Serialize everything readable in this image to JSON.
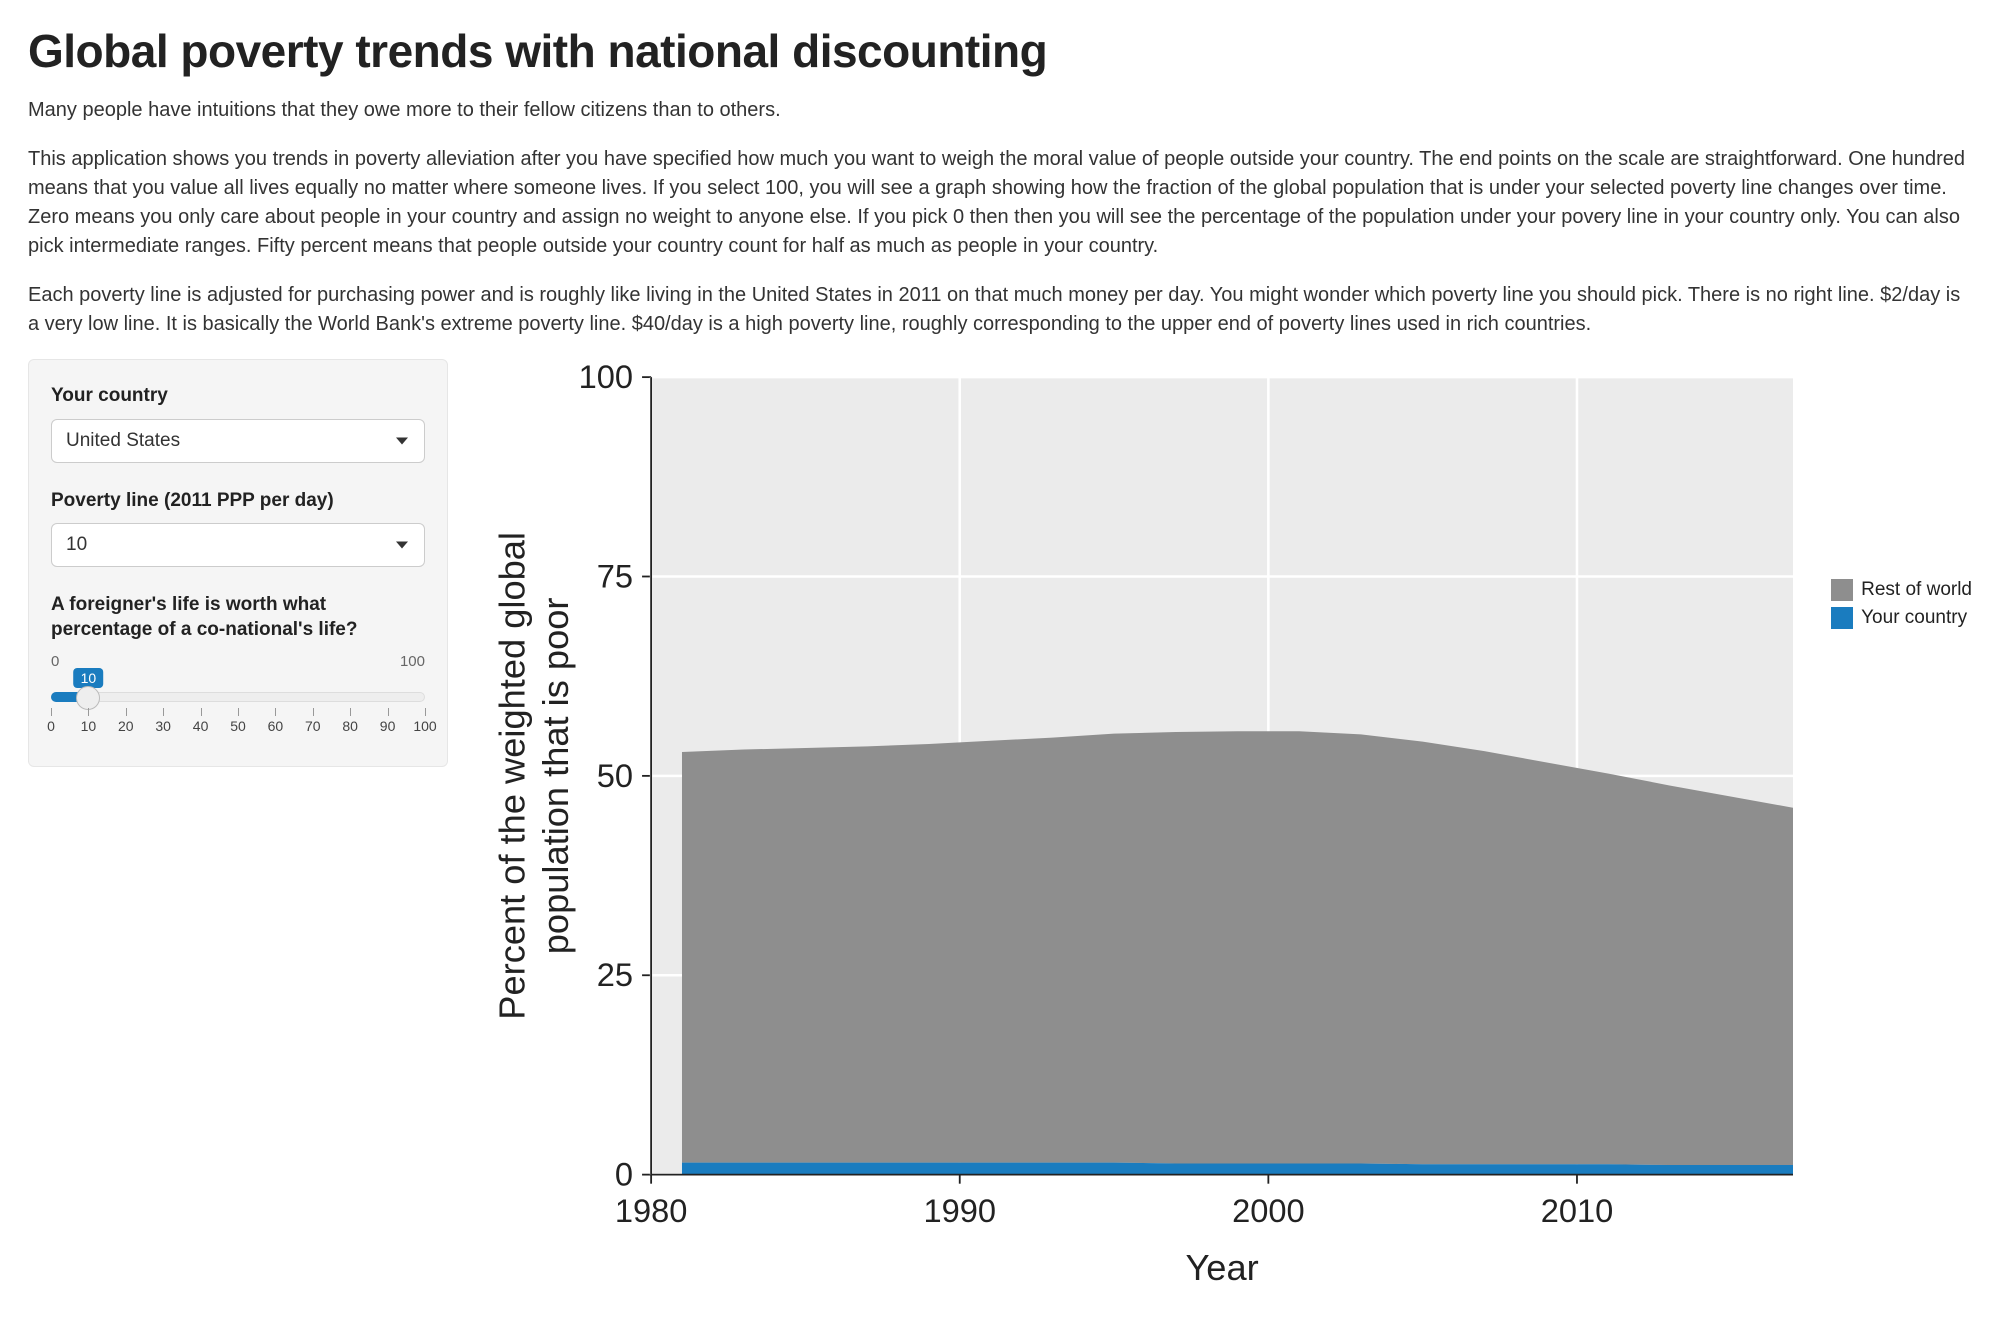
{
  "heading": "Global poverty trends with national discounting",
  "paragraphs": [
    "Many people have intuitions that they owe more to their fellow citizens than to others.",
    "This application shows you trends in poverty alleviation after you have specified how much you want to weigh the moral value of people outside your country. The end points on the scale are straightforward. One hundred means that you value all lives equally no matter where someone lives. If you select 100, you will see a graph showing how the fraction of the global population that is under your selected poverty line changes over time. Zero means you only care about people in your country and assign no weight to anyone else. If you pick 0 then then you will see the percentage of the population under your povery line in your country only. You can also pick intermediate ranges. Fifty percent means that people outside your country count for half as much as people in your country.",
    "Each poverty line is adjusted for purchasing power and is roughly like living in the United States in 2011 on that much money per day. You might wonder which poverty line you should pick. There is no right line. $2/day is a very low line. It is basically the World Bank's extreme poverty line. $40/day is a high poverty line, roughly corresponding to the upper end of poverty lines used in rich countries."
  ],
  "controls": {
    "country_label": "Your country",
    "country_value": "United States",
    "poverty_label": "Poverty line (2011 PPP per day)",
    "poverty_value": "10",
    "slider_label": "A foreigner's life is worth what percentage of a co-national's life?",
    "slider_min_label": "0",
    "slider_max_label": "100",
    "slider_value": "10",
    "slider_ticks": [
      "0",
      "10",
      "20",
      "30",
      "40",
      "50",
      "60",
      "70",
      "80",
      "90",
      "100"
    ]
  },
  "legend": {
    "rest_label": "Rest of world",
    "your_label": "Your country"
  },
  "chart_data": {
    "type": "area",
    "xlabel": "Year",
    "ylabel": "Percent of the weighted global population that is poor",
    "ylim": [
      0,
      100
    ],
    "xlim": [
      1980,
      2017
    ],
    "y_ticks": [
      0,
      25,
      50,
      75,
      100
    ],
    "x_ticks": [
      1980,
      1990,
      2000,
      2010
    ],
    "colors": {
      "Rest of world": "#8e8e8e",
      "Your country": "#1a7cbf",
      "panel_bg": "#ebebeb"
    },
    "series": [
      {
        "name": "Your country",
        "x": [
          1981,
          1983,
          1985,
          1987,
          1989,
          1991,
          1993,
          1995,
          1997,
          1999,
          2001,
          2003,
          2005,
          2007,
          2009,
          2011,
          2013,
          2015,
          2017
        ],
        "values": [
          1.5,
          1.5,
          1.5,
          1.5,
          1.5,
          1.5,
          1.5,
          1.5,
          1.4,
          1.4,
          1.4,
          1.4,
          1.3,
          1.3,
          1.3,
          1.3,
          1.2,
          1.2,
          1.2
        ]
      },
      {
        "name": "Rest of world",
        "x": [
          1981,
          1983,
          1985,
          1987,
          1989,
          1991,
          1993,
          1995,
          1997,
          1999,
          2001,
          2003,
          2005,
          2007,
          2009,
          2011,
          2013,
          2015,
          2017
        ],
        "values": [
          51.5,
          51.8,
          52.0,
          52.2,
          52.5,
          52.9,
          53.3,
          53.8,
          54.1,
          54.2,
          54.2,
          53.8,
          53.0,
          51.8,
          50.4,
          49.0,
          47.6,
          46.2,
          44.8
        ]
      }
    ]
  }
}
